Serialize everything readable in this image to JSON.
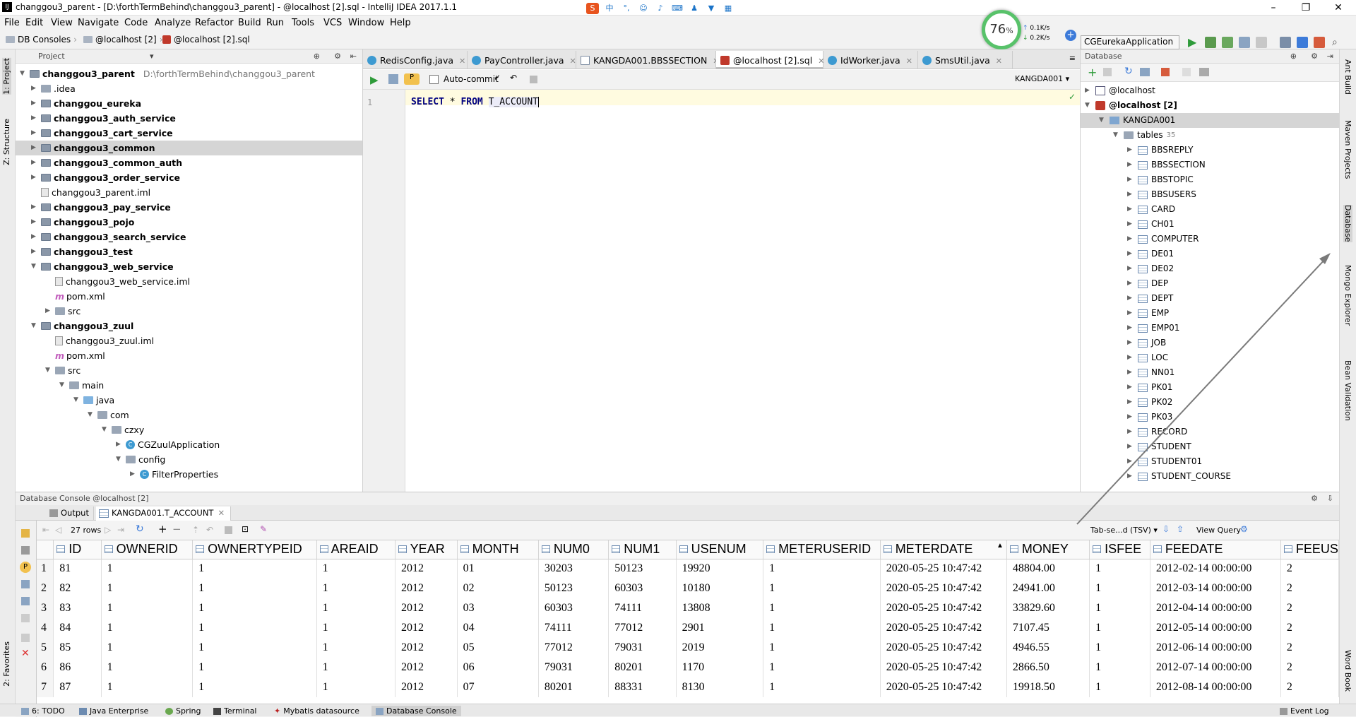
{
  "window": {
    "title": "changgou3_parent - [D:\\forthTermBehind\\changgou3_parent] - @localhost [2].sql - IntelliJ IDEA 2017.1.1"
  },
  "menu": [
    "File",
    "Edit",
    "View",
    "Navigate",
    "Code",
    "Analyze",
    "Refactor",
    "Build",
    "Run",
    "Tools",
    "VCS",
    "Window",
    "Help"
  ],
  "breadcrumb": [
    "DB Consoles",
    "@localhost [2]",
    "@localhost [2].sql"
  ],
  "speed": {
    "percent": "76",
    "unit": "%",
    "up": "0.1K/s",
    "down": "0.2K/s"
  },
  "run_config": "CGEurekaApplication",
  "left_tabs": [
    "1: Project",
    "Z: Structure",
    "2: Favorites"
  ],
  "right_tabs": [
    "Ant Build",
    "Maven Projects",
    "Database",
    "Mongo Explorer",
    "Bean Validation",
    "Word Book"
  ],
  "project": {
    "header": "Project",
    "root": {
      "name": "changgou3_parent",
      "path": "D:\\forthTermBehind\\changgou3_parent"
    },
    "nodes": [
      ".idea",
      "changgou_eureka",
      "changgou3_auth_service",
      "changgou3_cart_service",
      "changgou3_common",
      "changgou3_common_auth",
      "changgou3_order_service",
      "changgou3_parent.iml",
      "changgou3_pay_service",
      "changgou3_pojo",
      "changgou3_search_service",
      "changgou3_test",
      "changgou3_web_service",
      "changgou3_web_service.iml",
      "pom.xml",
      "src",
      "changgou3_zuul",
      "changgou3_zuul.iml",
      "pom.xml",
      "src",
      "main",
      "java",
      "com",
      "czxy",
      "CGZuulApplication",
      "config",
      "FilterProperties"
    ]
  },
  "editor": {
    "tabs": [
      "RedisConfig.java",
      "PayController.java",
      "KANGDA001.BBSSECTION",
      "@localhost [2].sql",
      "IdWorker.java",
      "SmsUtil.java"
    ],
    "autocommit": "Auto-commit",
    "schema": "KANGDA001",
    "line_no": "1",
    "code": {
      "kw1": "SELECT",
      "star": "*",
      "kw2": "FROM",
      "table": "T_ACCOUNT"
    }
  },
  "database": {
    "header": "Database",
    "hosts": [
      "@localhost",
      "@localhost [2]"
    ],
    "schema": "KANGDA001",
    "tables_label": "tables",
    "tables_count": "35",
    "tables": [
      "BBSREPLY",
      "BBSSECTION",
      "BBSTOPIC",
      "BBSUSERS",
      "CARD",
      "CH01",
      "COMPUTER",
      "DE01",
      "DE02",
      "DEP",
      "DEPT",
      "EMP",
      "EMP01",
      "JOB",
      "LOC",
      "NN01",
      "PK01",
      "PK02",
      "PK03",
      "RECORD",
      "STUDENT",
      "STUDENT01",
      "STUDENT_COURSE"
    ]
  },
  "console": {
    "header": "Database Console @localhost [2]",
    "tabs": [
      "Output",
      "KANGDA001.T_ACCOUNT"
    ],
    "rows_label": "27 rows",
    "export_label": "Tab-se...d (TSV)",
    "view_query": "View Query",
    "columns": [
      "ID",
      "OWNERID",
      "OWNERTYPEID",
      "AREAID",
      "YEAR",
      "MONTH",
      "NUM0",
      "NUM1",
      "USENUM",
      "METERUSERID",
      "METERDATE",
      "MONEY",
      "ISFEE",
      "FEEDATE",
      "FEEUS"
    ],
    "rows": [
      [
        "1",
        "81",
        "1",
        "1",
        "1",
        "2012",
        "01",
        "30203",
        "50123",
        "19920",
        "1",
        "2020-05-25 10:47:42",
        "48804.00",
        "1",
        "2012-02-14 00:00:00",
        "2"
      ],
      [
        "2",
        "82",
        "1",
        "1",
        "1",
        "2012",
        "02",
        "50123",
        "60303",
        "10180",
        "1",
        "2020-05-25 10:47:42",
        "24941.00",
        "1",
        "2012-03-14 00:00:00",
        "2"
      ],
      [
        "3",
        "83",
        "1",
        "1",
        "1",
        "2012",
        "03",
        "60303",
        "74111",
        "13808",
        "1",
        "2020-05-25 10:47:42",
        "33829.60",
        "1",
        "2012-04-14 00:00:00",
        "2"
      ],
      [
        "4",
        "84",
        "1",
        "1",
        "1",
        "2012",
        "04",
        "74111",
        "77012",
        "2901",
        "1",
        "2020-05-25 10:47:42",
        "7107.45",
        "1",
        "2012-05-14 00:00:00",
        "2"
      ],
      [
        "5",
        "85",
        "1",
        "1",
        "1",
        "2012",
        "05",
        "77012",
        "79031",
        "2019",
        "1",
        "2020-05-25 10:47:42",
        "4946.55",
        "1",
        "2012-06-14 00:00:00",
        "2"
      ],
      [
        "6",
        "86",
        "1",
        "1",
        "1",
        "2012",
        "06",
        "79031",
        "80201",
        "1170",
        "1",
        "2020-05-25 10:47:42",
        "2866.50",
        "1",
        "2012-07-14 00:00:00",
        "2"
      ],
      [
        "7",
        "87",
        "1",
        "1",
        "1",
        "2012",
        "07",
        "80201",
        "88331",
        "8130",
        "1",
        "2020-05-25 10:47:42",
        "19918.50",
        "1",
        "2012-08-14 00:00:00",
        "2"
      ]
    ]
  },
  "statusbar": [
    "6: TODO",
    "Java Enterprise",
    "Spring",
    "Terminal",
    "Mybatis datasource",
    "Database Console",
    "Event Log"
  ]
}
